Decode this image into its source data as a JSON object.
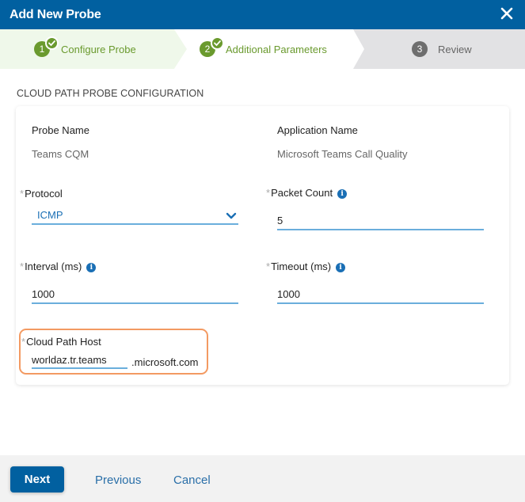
{
  "dialog": {
    "title": "Add New Probe",
    "close_icon": "close-x-icon"
  },
  "stepper": {
    "steps": [
      {
        "number": "1",
        "label": "Configure Probe",
        "state": "completed",
        "icon": "check-icon"
      },
      {
        "number": "2",
        "label": "Additional Parameters",
        "state": "completed-current",
        "icon": "check-icon"
      },
      {
        "number": "3",
        "label": "Review",
        "state": "pending"
      }
    ]
  },
  "section": {
    "title": "CLOUD PATH PROBE CONFIGURATION"
  },
  "form": {
    "probe_name": {
      "label": "Probe Name",
      "value": "Teams CQM"
    },
    "application_name": {
      "label": "Application Name",
      "value": "Microsoft Teams Call Quality"
    },
    "protocol": {
      "required_mark": "*",
      "label": "Protocol",
      "value": "ICMP",
      "icon": "chevron-down-icon"
    },
    "packet_count": {
      "required_mark": "*",
      "label": "Packet Count",
      "value": "5",
      "info_icon": "i"
    },
    "interval": {
      "required_mark": "*",
      "label": "Interval (ms)",
      "value": "1000",
      "info_icon": "i"
    },
    "timeout": {
      "required_mark": "*",
      "label": "Timeout (ms)",
      "value": "1000",
      "info_icon": "i"
    },
    "cloud_path_host": {
      "required_mark": "*",
      "label": "Cloud Path Host",
      "value": "worldaz.tr.teams",
      "suffix": ".microsoft.com"
    }
  },
  "footer": {
    "next_label": "Next",
    "previous_label": "Previous",
    "cancel_label": "Cancel"
  },
  "colors": {
    "brand": "#0160a0",
    "step_complete": "#6a9a2e",
    "step_pending": "#6e6e6e",
    "highlight": "#f39a62",
    "link": "#2a6fa8"
  }
}
